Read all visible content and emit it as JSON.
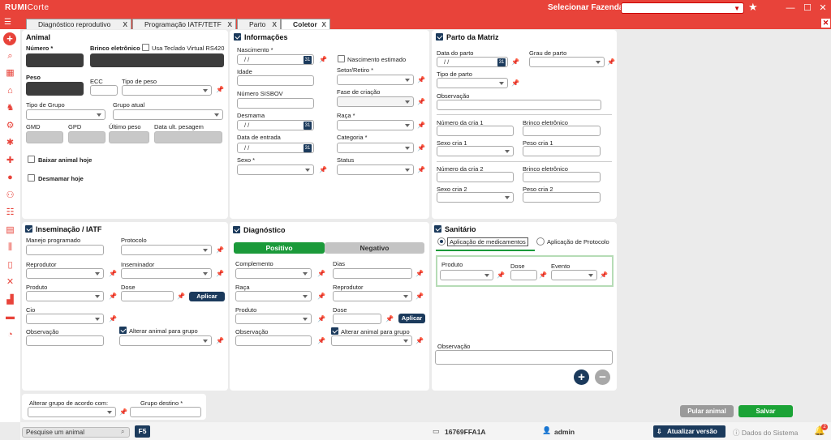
{
  "app": {
    "logo": "RUMI",
    "logo_suffix": "Corte",
    "farm_label": "Selecionar Fazenda",
    "farm_value": ""
  },
  "tabs": [
    {
      "label": "Diagnóstico reprodutivo",
      "close": "X"
    },
    {
      "label": "Programação IATF/TETF",
      "close": "X"
    },
    {
      "label": "Parto",
      "close": "X"
    },
    {
      "label": "Coletor",
      "close": "X"
    }
  ],
  "animal": {
    "title": "Animal",
    "numero": "Número *",
    "brinco": "Brinco eletrônico",
    "teclado": "Usa Teclado Virtual RS420",
    "peso": "Peso",
    "ecc": "ECC",
    "tipo_peso": "Tipo de peso",
    "tipo_grupo": "Tipo de Grupo",
    "grupo_atual": "Grupo atual",
    "gmd": "GMD",
    "gpd": "GPD",
    "ultimo_peso": "Último peso",
    "data_ult": "Data ult. pesagem",
    "baixar": "Baixar animal hoje",
    "desmamar": "Desmamar hoje"
  },
  "info": {
    "title": "Informações",
    "nascimento": "Nascimento *",
    "nasc_val": "/ /",
    "nasc_estimado": "Nascimento estimado",
    "idade": "Idade",
    "setor": "Setor/Retiro *",
    "sisbov": "Número SISBOV",
    "fase": "Fase de criação",
    "desmama": "Desmama",
    "desmama_val": "/ /",
    "raca": "Raça *",
    "entrada": "Data de entrada",
    "entrada_val": "/ /",
    "categoria": "Categoria *",
    "sexo": "Sexo *",
    "status": "Status",
    "cal_label": "31"
  },
  "parto": {
    "title": "Parto da Matriz",
    "data": "Data do parto",
    "data_val": "/ /",
    "grau": "Grau de parto",
    "tipo": "Tipo de parto",
    "obs": "Observação",
    "cria1": "Número da cria 1",
    "brinco1": "Brinco eletrônico",
    "sexo1": "Sexo cria 1",
    "peso1": "Peso cria 1",
    "cria2": "Número da cria 2",
    "brinco2": "Brinco eletrônico",
    "sexo2": "Sexo cria 2",
    "peso2": "Peso cria 2"
  },
  "iatf": {
    "title": "Inseminação / IATF",
    "manejo": "Manejo programado",
    "protocolo": "Protocolo",
    "reprodutor": "Reprodutor",
    "inseminador": "Inseminador",
    "produto": "Produto",
    "dose": "Dose",
    "aplicar": "Aplicar",
    "cio": "Cio",
    "obs": "Observação",
    "alterar": "Alterar animal para grupo"
  },
  "diag": {
    "title": "Diagnóstico",
    "positivo": "Positivo",
    "negativo": "Negativo",
    "complemento": "Complemento",
    "dias": "Dias",
    "raca": "Raça",
    "reprodutor": "Reprodutor",
    "produto": "Produto",
    "dose": "Dose",
    "aplicar": "Aplicar",
    "obs": "Observação",
    "alterar": "Alterar animal para grupo"
  },
  "sanitario": {
    "title": "Sanitário",
    "opt1": "Aplicação de medicamentos",
    "opt2": "Aplicação de Protocolo",
    "produto": "Produto",
    "dose": "Dose",
    "evento": "Evento",
    "obs": "Observação",
    "add": "+",
    "remove": "−"
  },
  "grupo": {
    "alterar": "Alterar grupo de acordo com:",
    "destino": "Grupo destino *"
  },
  "actions": {
    "pular": "Pular animal",
    "salvar": "Salvar"
  },
  "status": {
    "search_placeholder": "Pesquise um animal",
    "f5": "F5",
    "device": "16769FFA1A",
    "user": "admin",
    "atualizar": "Atualizar versão",
    "dados": "Dados do Sistema",
    "notif": "2"
  },
  "colors": {
    "brand": "#e8433a",
    "navy": "#1b3a5c",
    "green": "#1b9a3a"
  }
}
